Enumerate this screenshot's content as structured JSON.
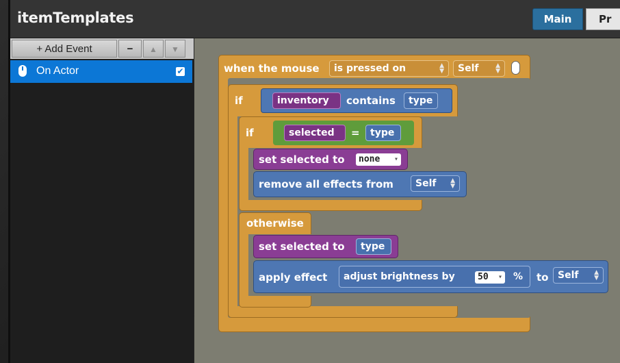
{
  "window": {
    "title": "itemTemplates"
  },
  "tabs": [
    {
      "label": "Main",
      "active": true
    },
    {
      "label": "Pr",
      "active": false
    }
  ],
  "sidebar": {
    "toolbar": {
      "add_label": "+ Add Event",
      "remove_label": "−",
      "up_label": "▲",
      "down_label": "▼"
    },
    "events": [
      {
        "label": "On Actor",
        "checked": true,
        "check_glyph": "✔",
        "icon": "mouse-icon"
      }
    ]
  },
  "blocks": {
    "when": {
      "prefix": "when the mouse",
      "condition": "is pressed on",
      "target": "Self",
      "icon": "mouse-icon"
    },
    "if1": {
      "keyword": "if",
      "left": "inventory",
      "op": "contains",
      "right": "type"
    },
    "if2": {
      "keyword": "if",
      "left": "selected",
      "op": "=",
      "right": "type"
    },
    "set1": {
      "label": "set selected to",
      "value": "none"
    },
    "remove": {
      "label": "remove all effects from",
      "target": "Self"
    },
    "otherwise": {
      "keyword": "otherwise"
    },
    "set2": {
      "label": "set selected to",
      "value": "type"
    },
    "apply": {
      "label": "apply effect",
      "effect": "adjust brightness by",
      "amount": "50",
      "unit": "%",
      "to": "to",
      "target": "Self"
    }
  },
  "colors": {
    "accent": "#0c77d6",
    "event_block": "#d69a3c",
    "variable_block": "#8a3d94",
    "action_block": "#4e77b3",
    "logic_block": "#5f9c3b",
    "canvas": "#7d7d71"
  }
}
